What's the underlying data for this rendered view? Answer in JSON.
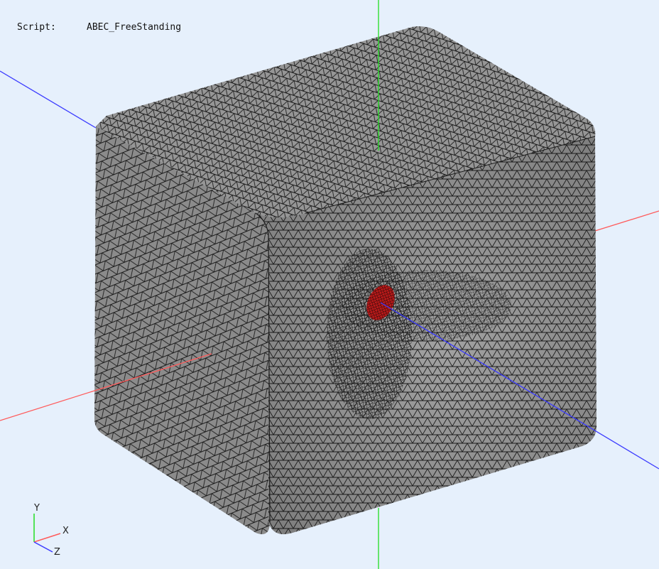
{
  "viewer": {
    "script_label": "Script:",
    "script_name": "ABEC_FreeStanding",
    "background": "#e6f0fc"
  },
  "axes": {
    "x_color": "#ff5a5a",
    "y_color": "#22dd22",
    "z_color": "#3b3bff"
  },
  "triad": {
    "y_label": "Y",
    "x_label": "X",
    "z_label": "Z"
  },
  "model": {
    "mesh_fill": "#8c8c8c",
    "mesh_line": "#111111",
    "source_color": "#c21b1b"
  }
}
